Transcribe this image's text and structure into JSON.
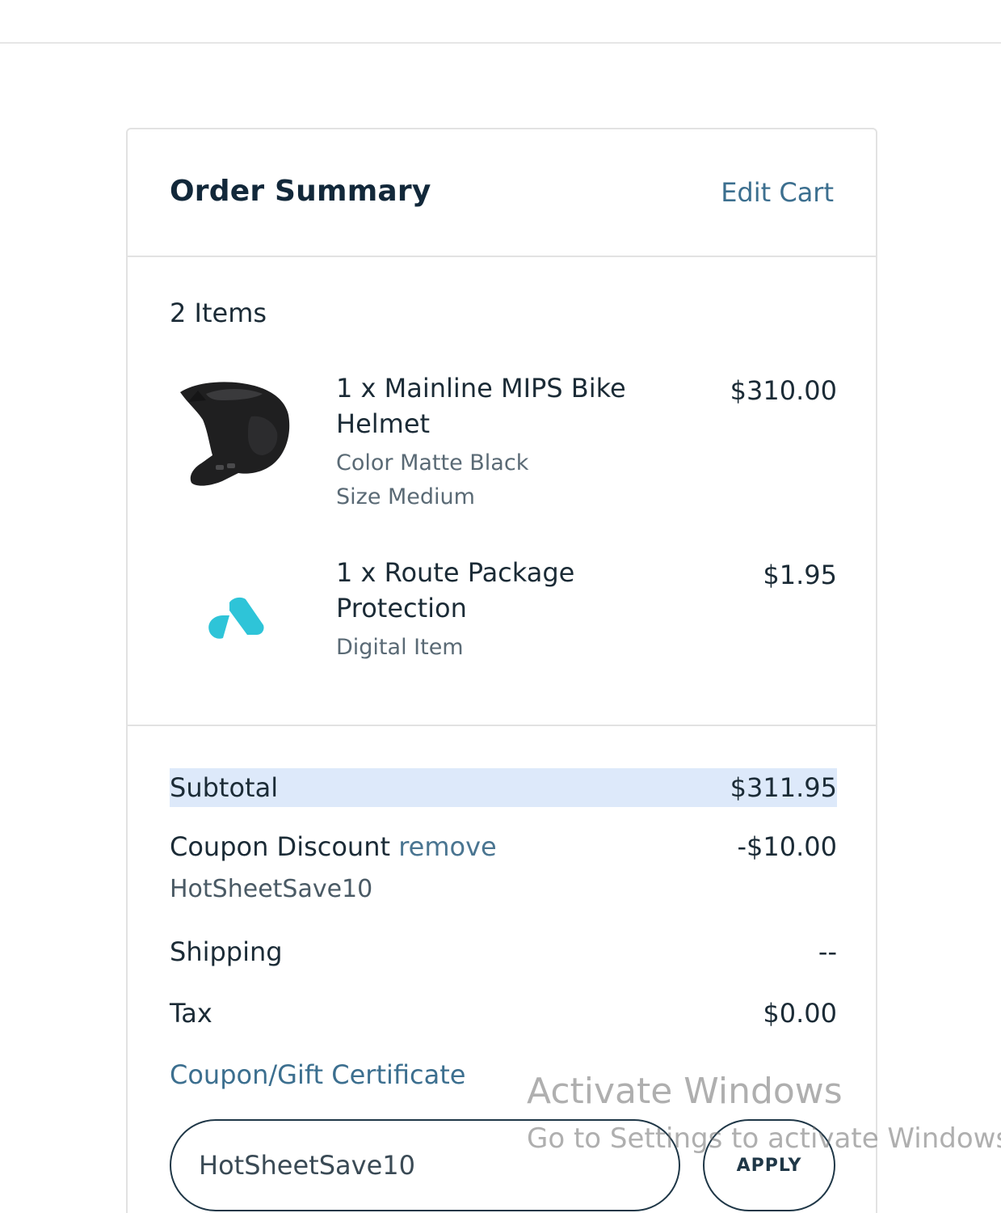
{
  "order_summary": {
    "title": "Order Summary",
    "edit_cart_label": "Edit Cart",
    "items_count": "2 Items",
    "items": [
      {
        "name": "1 x Mainline MIPS Bike Helmet",
        "options": [
          "Color Matte Black",
          "Size Medium"
        ],
        "price": "$310.00",
        "thumbnail_icon": "bike-helmet-icon"
      },
      {
        "name": "1 x Route Package Protection",
        "options": [
          "Digital Item"
        ],
        "price": "$1.95",
        "thumbnail_icon": "route-logo-icon"
      }
    ],
    "totals": {
      "subtotal_label": "Subtotal",
      "subtotal_value": "$311.95",
      "coupon_label": "Coupon Discount",
      "coupon_remove_label": "remove",
      "coupon_value": "-$10.00",
      "coupon_code": "HotSheetSave10",
      "shipping_label": "Shipping",
      "shipping_value": "--",
      "tax_label": "Tax",
      "tax_value": "$0.00"
    },
    "coupon_form": {
      "label": "Coupon/Gift Certificate",
      "input_value": "HotSheetSave10",
      "apply_label": "APPLY"
    }
  },
  "watermark": {
    "title": "Activate Windows",
    "subtitle": "Go to Settings to activate Windows."
  },
  "colors": {
    "title": "#12283a",
    "link": "#3c6f8f",
    "subtotal_highlight": "#dde9fa",
    "route_brand": "#2ec4d8"
  }
}
